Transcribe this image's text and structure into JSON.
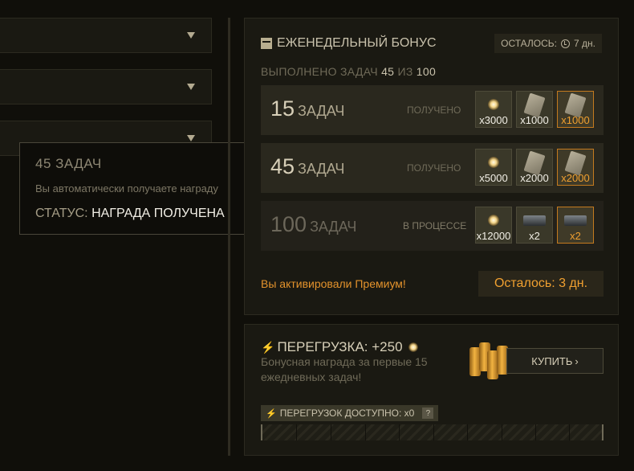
{
  "tooltip": {
    "title": "45 ЗАДАЧ",
    "description": "Вы автоматически получаете награду",
    "status_label": "СТАТУС:",
    "status_value": "НАГРАДА ПОЛУЧЕНА"
  },
  "weekly": {
    "title": "ЕЖЕНЕДЕЛЬНЫЙ БОНУС",
    "remaining_label": "ОСТАЛОСЬ:",
    "remaining_value": "7 дн.",
    "progress_prefix": "ВЫПОЛНЕНО ЗАДАЧ",
    "progress_done": "45",
    "progress_sep": "ИЗ",
    "progress_total": "100",
    "tiers": [
      {
        "count": "15",
        "unit": "ЗАДАЧ",
        "state": "ПОЛУЧЕНО",
        "rewards": [
          {
            "icon": "spark-icon",
            "qty": "x3000",
            "premium": false
          },
          {
            "icon": "plate-icon",
            "qty": "x1000",
            "premium": false
          },
          {
            "icon": "plate-icon",
            "qty": "x1000",
            "premium": true
          }
        ]
      },
      {
        "count": "45",
        "unit": "ЗАДАЧ",
        "state": "ПОЛУЧЕНО",
        "rewards": [
          {
            "icon": "spark-icon",
            "qty": "x5000",
            "premium": false
          },
          {
            "icon": "plate-icon",
            "qty": "x2000",
            "premium": false
          },
          {
            "icon": "plate-icon",
            "qty": "x2000",
            "premium": true
          }
        ]
      },
      {
        "count": "100",
        "unit": "ЗАДАЧ",
        "state": "В ПРОЦЕССЕ",
        "rewards": [
          {
            "icon": "spark-icon",
            "qty": "x12000",
            "premium": false
          },
          {
            "icon": "case-icon",
            "qty": "x2",
            "premium": false
          },
          {
            "icon": "case-icon",
            "qty": "x2",
            "premium": true
          }
        ]
      }
    ],
    "premium_note": "Вы активировали Премиум!",
    "premium_remaining": "Осталось: 3 дн."
  },
  "overload": {
    "title": "ПЕРЕГРУЗКА: +250",
    "description": "Бонусная награда за первые 15 ежедневных задач!",
    "buy_label": "КУПИТЬ",
    "available_label": "ПЕРЕГРУЗОК ДОСТУПНО: x0",
    "help_label": "?",
    "progress": 0
  },
  "colors": {
    "accent": "#f0a030",
    "background": "#100f0a",
    "panel": "#1a1912"
  }
}
